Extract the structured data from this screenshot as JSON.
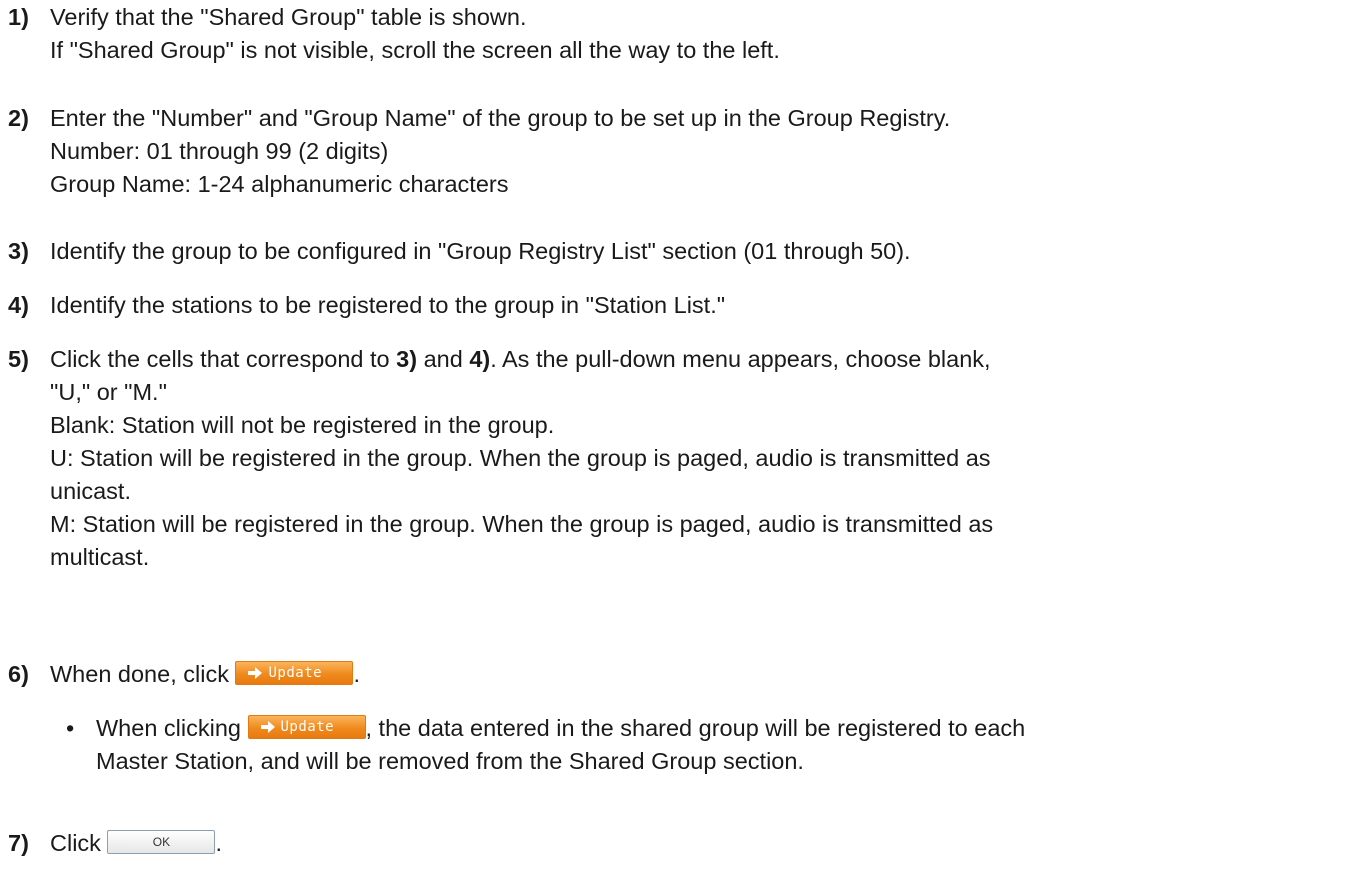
{
  "steps": [
    {
      "num": "1)",
      "lines": [
        "Verify that the \"Shared Group\" table is shown.",
        "If \"Shared Group\" is not visible, scroll the screen all the way to the left."
      ]
    },
    {
      "num": "2)",
      "lines": [
        "Enter the \"Number\" and \"Group Name\" of the group to be set up in the Group Registry.",
        "Number: 01 through 99 (2 digits)",
        "Group Name: 1-24 alphanumeric characters"
      ]
    },
    {
      "num": "3)",
      "lines": [
        "Identify the group to be configured in \"Group Registry List\" section (01 through 50)."
      ]
    },
    {
      "num": "4)",
      "lines": [
        "Identify the stations to be registered to the group in \"Station List.\""
      ]
    },
    {
      "num": "5)",
      "first_a": "Click the cells that correspond to ",
      "ref_a": "3)",
      "first_b": " and ",
      "ref_b": "4)",
      "first_c": ". As the pull-down menu appears, choose blank,",
      "line2": "\"U,\" or \"M.\"",
      "line3": "Blank: Station will not be registered in the group.",
      "line4": "U: Station will be registered in the group. When the group is paged, audio is transmitted as",
      "line5": "unicast.",
      "line6": "M: Station will be registered in the group. When the group is paged, audio is transmitted as",
      "line7": "multicast."
    },
    {
      "num": "6)",
      "before": "When done, click ",
      "after": "."
    },
    {
      "num": "7)",
      "before": "Click ",
      "after": "."
    }
  ],
  "note": {
    "bullet": "•",
    "before": "When clicking ",
    "after": ", the data entered in the shared group will be registered to each",
    "line2": "Master Station, and will be removed from the Shared Group section."
  },
  "buttons": {
    "update_label": "Update",
    "ok_label": "OK",
    "update_color": "#f08a1e",
    "update_icon": "arrow-right-icon"
  }
}
